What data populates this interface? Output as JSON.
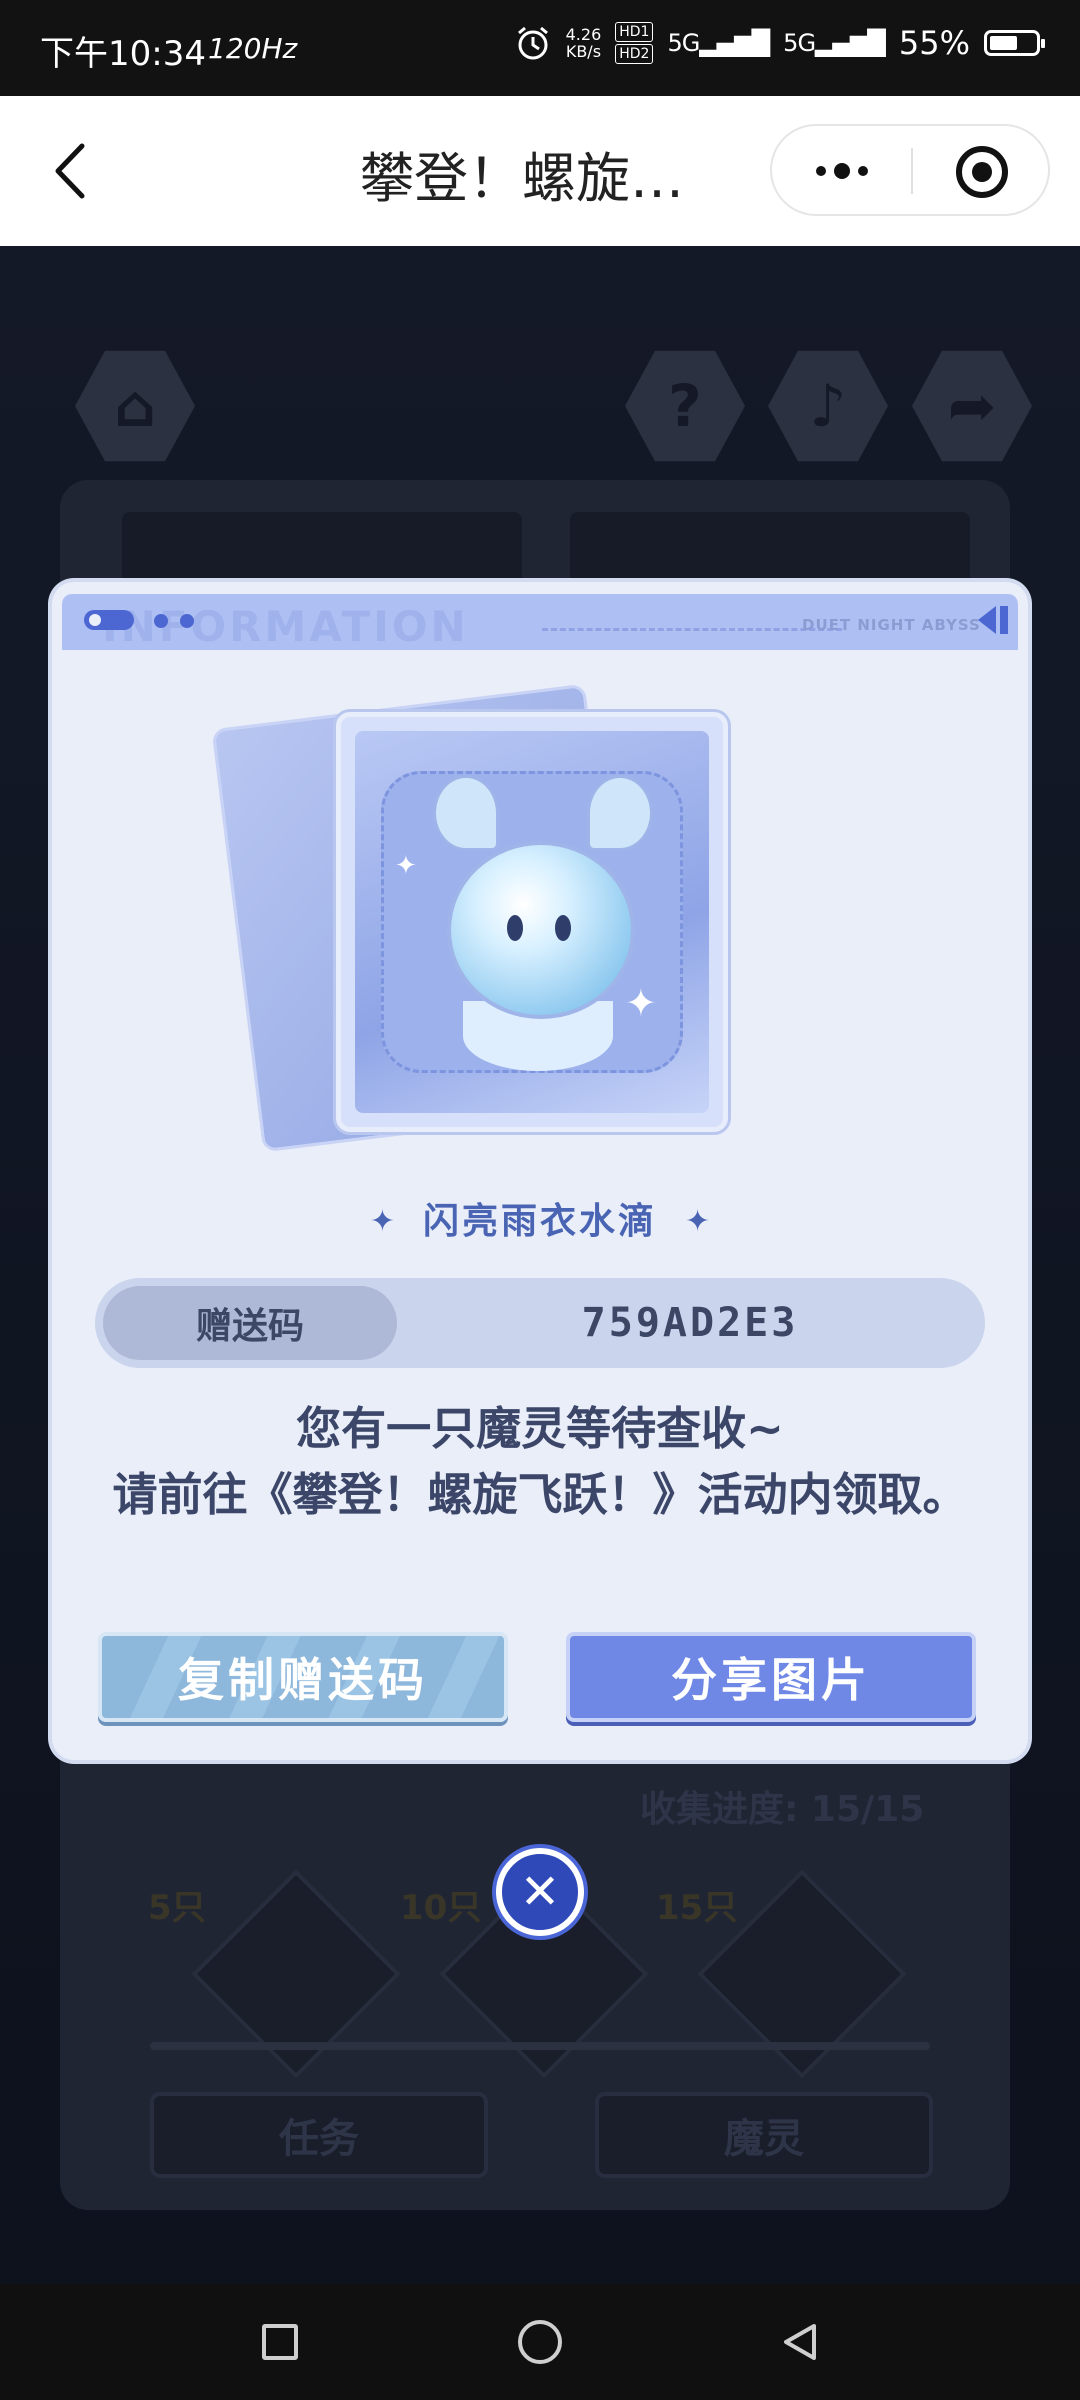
{
  "status_bar": {
    "time": "下午10:34",
    "refresh": "120Hz",
    "speed": "4.26",
    "speed_unit": "KB/s",
    "hd1": "HD1",
    "hd2": "HD2",
    "net1": "5G",
    "net2": "5G",
    "battery": "55%"
  },
  "title_bar": {
    "title": "攀登！螺旋…",
    "back_icon": "chevron-left-icon",
    "more_icon": "more-dots-icon",
    "close_icon": "target-circle-icon"
  },
  "game": {
    "top_icons": [
      "home-icon",
      "help-icon",
      "music-icon",
      "share-icon"
    ],
    "progress_label": "收集进度: 15/15",
    "milestones": [
      "5只",
      "10只",
      "15只"
    ],
    "tabs": [
      "任务",
      "魔灵"
    ]
  },
  "modal": {
    "header_watermark": "INFORMATION",
    "header_brand": "DUET NIGHT ABYSS",
    "item_name": "闪亮雨衣水滴",
    "gift_code_label": "赠送码",
    "gift_code": "759AD2E3",
    "message_line1": "您有一只魔灵等待查收~",
    "message_line2": "请前往《攀登！螺旋飞跃！》活动内领取。",
    "copy_button": "复制赠送码",
    "share_button": "分享图片",
    "close_icon": "close-x-icon"
  },
  "colors": {
    "accent": "#6f88e6",
    "modal_bg": "#e9eef9",
    "text_dark": "#3b4668"
  }
}
